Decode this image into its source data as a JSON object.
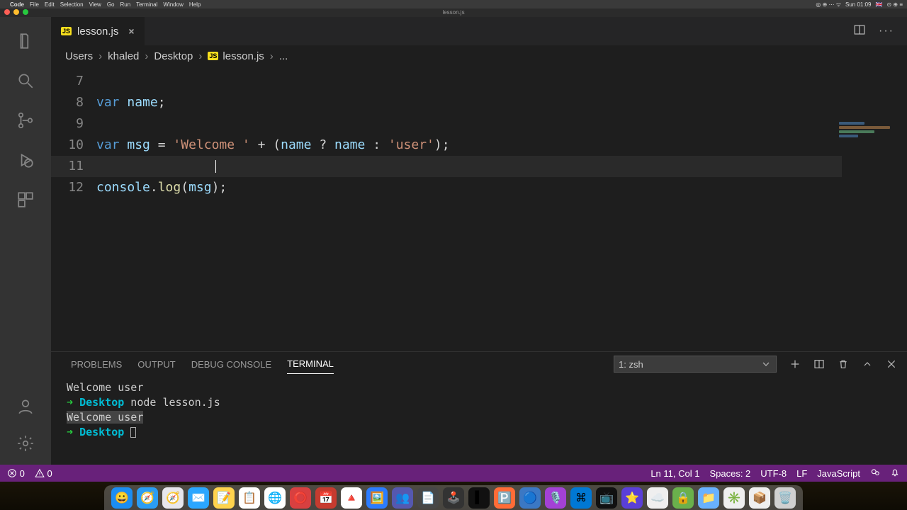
{
  "mac_menu": {
    "app": "Code",
    "items": [
      "File",
      "Edit",
      "Selection",
      "View",
      "Go",
      "Run",
      "Terminal",
      "Window",
      "Help"
    ],
    "clock": "Sun 01:09",
    "flag": "🇬🇧"
  },
  "window_title": "lesson.js",
  "tab": {
    "filename": "lesson.js"
  },
  "tab_actions": {},
  "breadcrumb": {
    "segments": [
      "Users",
      "khaled",
      "Desktop"
    ],
    "file": "lesson.js",
    "tail": "..."
  },
  "code": {
    "first_line_no": 7,
    "lines": [
      {
        "no": 7,
        "t": ""
      },
      {
        "no": 8,
        "t": "var name;"
      },
      {
        "no": 9,
        "t": ""
      },
      {
        "no": 10,
        "t": "var msg = 'Welcome ' + (name ? name : 'user');"
      },
      {
        "no": 11,
        "t": ""
      },
      {
        "no": 12,
        "t": "console.log(msg);"
      }
    ],
    "cursor_line": 11
  },
  "panel": {
    "tabs": [
      "PROBLEMS",
      "OUTPUT",
      "DEBUG CONSOLE",
      "TERMINAL"
    ],
    "active_tab": "TERMINAL",
    "terminal_select": "1: zsh",
    "terminal_lines": [
      {
        "kind": "out",
        "text": "Welcome user"
      },
      {
        "kind": "prompt",
        "dir": "Desktop",
        "cmd": "node lesson.js"
      },
      {
        "kind": "out_hl",
        "text": "Welcome user"
      },
      {
        "kind": "prompt",
        "dir": "Desktop",
        "cmd": ""
      }
    ]
  },
  "status": {
    "errors": "0",
    "warnings": "0",
    "ln_col": "Ln 11, Col 1",
    "spaces": "Spaces: 2",
    "encoding": "UTF-8",
    "eol": "LF",
    "lang": "JavaScript"
  },
  "dock_apps": [
    {
      "n": "finder",
      "c": "#1b8df2",
      "g": "😀"
    },
    {
      "n": "safari",
      "c": "#2a9df4",
      "g": "🧭"
    },
    {
      "n": "safari2",
      "c": "#e7e7ec",
      "g": "🧭"
    },
    {
      "n": "mail",
      "c": "#2aa6ff",
      "g": "✉️"
    },
    {
      "n": "notes",
      "c": "#ffd34d",
      "g": "📝"
    },
    {
      "n": "reminders",
      "c": "#ffffff",
      "g": "📋"
    },
    {
      "n": "chrome",
      "c": "#ffffff",
      "g": "🌐"
    },
    {
      "n": "opera",
      "c": "#d84040",
      "g": "⭕"
    },
    {
      "n": "drc",
      "c": "#c63b2f",
      "g": "📅"
    },
    {
      "n": "gdrive",
      "c": "#ffffff",
      "g": "🔺"
    },
    {
      "n": "preview",
      "c": "#2b7cff",
      "g": "🖼️"
    },
    {
      "n": "teams",
      "c": "#5558af",
      "g": "👥"
    },
    {
      "n": "sublime",
      "c": "#474747",
      "g": "📄"
    },
    {
      "n": "dashboard",
      "c": "#333",
      "g": "🕹️"
    },
    {
      "n": "terminal",
      "c": "#111",
      "g": "▌"
    },
    {
      "n": "postman",
      "c": "#ff6c37",
      "g": "🅿️"
    },
    {
      "n": "app1",
      "c": "#3b78c4",
      "g": "🔵"
    },
    {
      "n": "podcast",
      "c": "#a341d6",
      "g": "🎙️"
    },
    {
      "n": "vscode",
      "c": "#0078d4",
      "g": "⌘"
    },
    {
      "n": "tv",
      "c": "#111",
      "g": "📺"
    },
    {
      "n": "imovie",
      "c": "#5a3fd8",
      "g": "⭐"
    },
    {
      "n": "app2",
      "c": "#efefef",
      "g": "☁️"
    },
    {
      "n": "lock",
      "c": "#6ab04c",
      "g": "🔒"
    },
    {
      "n": "folder",
      "c": "#68b1ff",
      "g": "📁"
    },
    {
      "n": "slack",
      "c": "#efefef",
      "g": "✳️"
    },
    {
      "n": "app3",
      "c": "#efefef",
      "g": "📦"
    },
    {
      "n": "trash",
      "c": "#d0d0d0",
      "g": "🗑️"
    }
  ]
}
